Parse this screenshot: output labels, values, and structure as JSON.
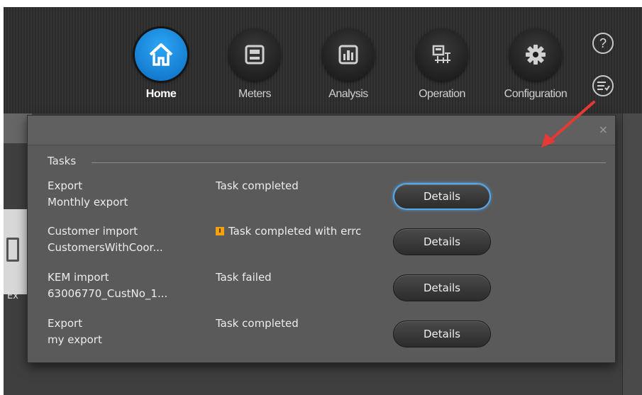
{
  "nav": {
    "items": [
      {
        "label": "Home",
        "icon": "home-icon",
        "active": true
      },
      {
        "label": "Meters",
        "icon": "meter-icon",
        "active": false
      },
      {
        "label": "Analysis",
        "icon": "bar-chart-icon",
        "active": false
      },
      {
        "label": "Operation",
        "icon": "operation-icon",
        "active": false
      },
      {
        "label": "Configuration",
        "icon": "gear-icon",
        "active": false
      }
    ],
    "help_symbol": "?"
  },
  "side": {
    "tile_label": "Ex"
  },
  "panel": {
    "close_symbol": "×",
    "section_title": "Tasks",
    "tasks": [
      {
        "name": "Export",
        "detail": "Monthly export",
        "status": "Task completed",
        "warning": false,
        "button": "Details"
      },
      {
        "name": "Customer import",
        "detail": "CustomersWithCoor...",
        "status": "Task completed with errc",
        "warning": true,
        "button": "Details"
      },
      {
        "name": "KEM import",
        "detail": "63006770_CustNo_1...",
        "status": "Task failed",
        "warning": false,
        "button": "Details"
      },
      {
        "name": "Export",
        "detail": "my export",
        "status": "Task completed",
        "warning": false,
        "button": "Details"
      }
    ]
  },
  "colors": {
    "active_nav": "#1e90e8",
    "focus_ring": "#5aa7e6",
    "warning": "#f2a20f",
    "annotation_arrow": "#e53935"
  }
}
